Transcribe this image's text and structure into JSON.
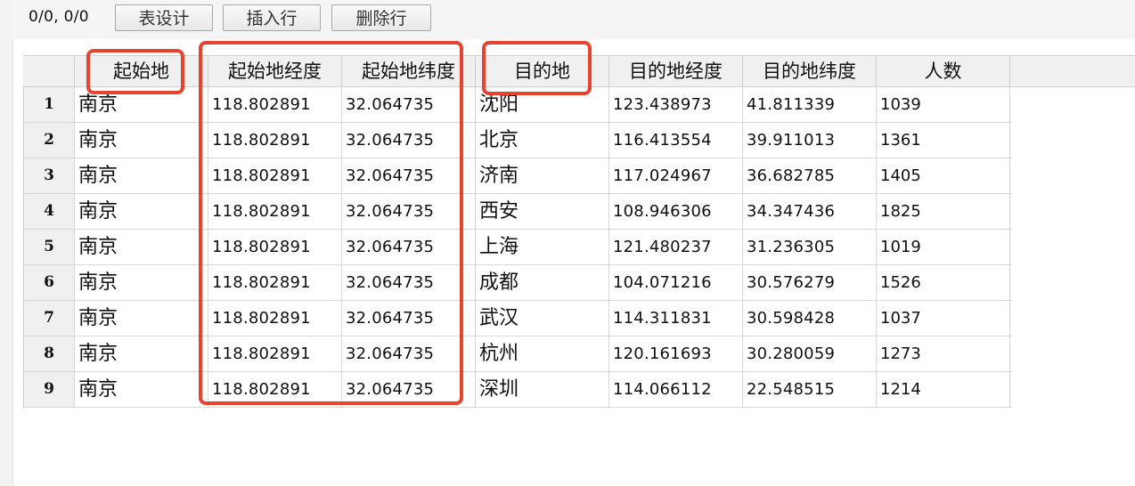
{
  "toolbar": {
    "position": "0/0, 0/0",
    "design_label": "表设计",
    "insert_label": "插入行",
    "delete_label": "删除行"
  },
  "table": {
    "columns": [
      "起始地",
      "起始地经度",
      "起始地纬度",
      "目的地",
      "目的地经度",
      "目的地纬度",
      "人数"
    ],
    "rows": [
      {
        "n": "1",
        "origin": "南京",
        "olng": "118.802891",
        "olat": "32.064735",
        "dest": "沈阳",
        "dlng": "123.438973",
        "dlat": "41.811339",
        "count": "1039"
      },
      {
        "n": "2",
        "origin": "南京",
        "olng": "118.802891",
        "olat": "32.064735",
        "dest": "北京",
        "dlng": "116.413554",
        "dlat": "39.911013",
        "count": "1361"
      },
      {
        "n": "3",
        "origin": "南京",
        "olng": "118.802891",
        "olat": "32.064735",
        "dest": "济南",
        "dlng": "117.024967",
        "dlat": "36.682785",
        "count": "1405"
      },
      {
        "n": "4",
        "origin": "南京",
        "olng": "118.802891",
        "olat": "32.064735",
        "dest": "西安",
        "dlng": "108.946306",
        "dlat": "34.347436",
        "count": "1825"
      },
      {
        "n": "5",
        "origin": "南京",
        "olng": "118.802891",
        "olat": "32.064735",
        "dest": "上海",
        "dlng": "121.480237",
        "dlat": "31.236305",
        "count": "1019"
      },
      {
        "n": "6",
        "origin": "南京",
        "olng": "118.802891",
        "olat": "32.064735",
        "dest": "成都",
        "dlng": "104.071216",
        "dlat": "30.576279",
        "count": "1526"
      },
      {
        "n": "7",
        "origin": "南京",
        "olng": "118.802891",
        "olat": "32.064735",
        "dest": "武汉",
        "dlng": "114.311831",
        "dlat": "30.598428",
        "count": "1037"
      },
      {
        "n": "8",
        "origin": "南京",
        "olng": "118.802891",
        "olat": "32.064735",
        "dest": "杭州",
        "dlng": "120.161693",
        "dlat": "30.280059",
        "count": "1273"
      },
      {
        "n": "9",
        "origin": "南京",
        "olng": "118.802891",
        "olat": "32.064735",
        "dest": "深圳",
        "dlng": "114.066112",
        "dlat": "22.548515",
        "count": "1214"
      }
    ]
  },
  "highlight_color": "#e8432e"
}
